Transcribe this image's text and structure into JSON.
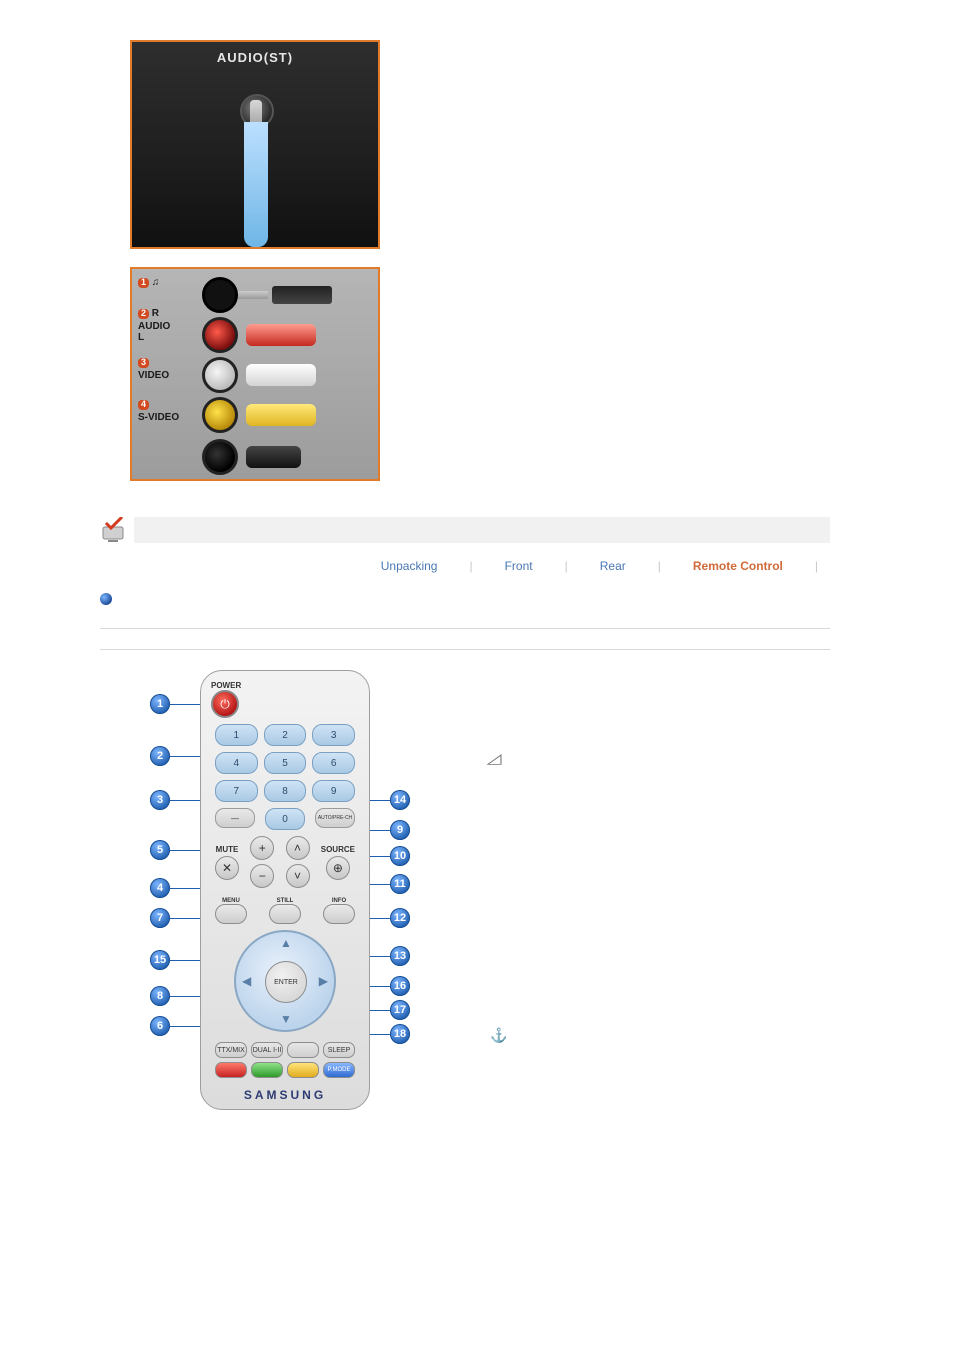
{
  "photo1": {
    "label": "AUDIO(ST)"
  },
  "photo2": {
    "labels": {
      "num1": "1",
      "headphone_glyph": "♫",
      "num2": "2",
      "audio_r": "R",
      "audio_text": "AUDIO",
      "audio_l": "L",
      "num3": "3",
      "video_text": "VIDEO",
      "num4": "4",
      "svideo_text": "S-VIDEO"
    }
  },
  "subnav": {
    "items": [
      {
        "label": "Unpacking",
        "active": false
      },
      {
        "label": "Front",
        "active": false
      },
      {
        "label": "Rear",
        "active": false
      },
      {
        "label": "Remote Control",
        "active": true
      }
    ],
    "separator": "|"
  },
  "remote": {
    "power_label": "POWER",
    "power_glyph": "⏻",
    "num_buttons": [
      "1",
      "2",
      "3",
      "4",
      "5",
      "6",
      "7",
      "8",
      "9"
    ],
    "row3_left_glyph": "—",
    "row3_mid": "0",
    "row3_right_label": "AUTO/PRE-CH",
    "mute_label": "MUTE",
    "source_label": "SOURCE",
    "info_label": "INFO",
    "menu_label": "MENU",
    "enter_label": "ENTER",
    "still_label": "STILL",
    "ttx_label": "TTX/MIX",
    "dual_label": "DUAL I-II",
    "sleep_label": "SLEEP",
    "pmode_label": "P.MODE",
    "brand": "SAMSUNG",
    "callouts_left": [
      "1",
      "2",
      "3",
      "5",
      "4",
      "7",
      "15",
      "8",
      "6"
    ],
    "callouts_right": [
      "14",
      "9",
      "10",
      "11",
      "12",
      "13",
      "16",
      "17",
      "18"
    ]
  },
  "side_glyphs": {
    "arrow": "◿",
    "anchor": "⚓"
  }
}
